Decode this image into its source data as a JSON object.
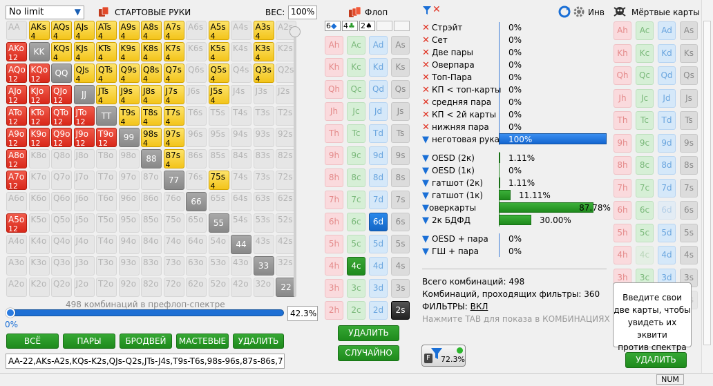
{
  "left": {
    "limit_select": "No limit",
    "title": "СТАРТОВЫЕ РУКИ",
    "weight_label": "ВЕС:",
    "weight_value": "100%",
    "combos_caption": "498 комбинаций в префлоп-спектре",
    "slider_low": "0%",
    "slider_value": "42.3%",
    "buttons": [
      "ВСЁ",
      "ПАРЫ",
      "БРОДВЕЙ",
      "МАСТЕВЫЕ",
      "УДАЛИТЬ"
    ],
    "range_text": "AA-22,AKs-A2s,KQs-K2s,QJs-Q2s,JTs-J4s,T9s-T6s,98s-96s,87s-86s,7",
    "grid": [
      [
        [
          "AA",
          "",
          "e"
        ],
        [
          "AKs",
          "4",
          "y"
        ],
        [
          "AQs",
          "4",
          "y"
        ],
        [
          "AJs",
          "4",
          "y"
        ],
        [
          "ATs",
          "4",
          "y"
        ],
        [
          "A9s",
          "4",
          "y"
        ],
        [
          "A8s",
          "4",
          "y"
        ],
        [
          "A7s",
          "4",
          "y"
        ],
        [
          "A6s",
          "",
          "e"
        ],
        [
          "A5s",
          "4",
          "y"
        ],
        [
          "A4s",
          "",
          "e"
        ],
        [
          "A3s",
          "4",
          "y"
        ],
        [
          "A2s",
          "",
          "e"
        ]
      ],
      [
        [
          "AKo",
          "12",
          "r"
        ],
        [
          "KK",
          "",
          "p"
        ],
        [
          "KQs",
          "4",
          "y"
        ],
        [
          "KJs",
          "4",
          "y"
        ],
        [
          "KTs",
          "4",
          "y"
        ],
        [
          "K9s",
          "4",
          "y"
        ],
        [
          "K8s",
          "4",
          "y"
        ],
        [
          "K7s",
          "4",
          "y"
        ],
        [
          "K6s",
          "",
          "e"
        ],
        [
          "K5s",
          "4",
          "y"
        ],
        [
          "K4s",
          "",
          "e"
        ],
        [
          "K3s",
          "4",
          "y"
        ],
        [
          "K2s",
          "",
          "e"
        ]
      ],
      [
        [
          "AQo",
          "12",
          "r"
        ],
        [
          "KQo",
          "12",
          "r"
        ],
        [
          "QQ",
          "",
          "p"
        ],
        [
          "QJs",
          "4",
          "y"
        ],
        [
          "QTs",
          "4",
          "y"
        ],
        [
          "Q9s",
          "4",
          "y"
        ],
        [
          "Q8s",
          "4",
          "y"
        ],
        [
          "Q7s",
          "4",
          "y"
        ],
        [
          "Q6s",
          "",
          "e"
        ],
        [
          "Q5s",
          "4",
          "y"
        ],
        [
          "Q4s",
          "",
          "e"
        ],
        [
          "Q3s",
          "4",
          "y"
        ],
        [
          "Q2s",
          "",
          "e"
        ]
      ],
      [
        [
          "AJo",
          "12",
          "r"
        ],
        [
          "KJo",
          "12",
          "r"
        ],
        [
          "QJo",
          "12",
          "r"
        ],
        [
          "JJ",
          "",
          "p"
        ],
        [
          "JTs",
          "4",
          "y"
        ],
        [
          "J9s",
          "4",
          "y"
        ],
        [
          "J8s",
          "4",
          "y"
        ],
        [
          "J7s",
          "4",
          "y"
        ],
        [
          "J6s",
          "",
          "e"
        ],
        [
          "J5s",
          "4",
          "y"
        ],
        [
          "J4s",
          "",
          "e"
        ],
        [
          "J3s",
          "",
          "e"
        ],
        [
          "J2s",
          "",
          "e"
        ]
      ],
      [
        [
          "ATo",
          "12",
          "r"
        ],
        [
          "KTo",
          "12",
          "r"
        ],
        [
          "QTo",
          "12",
          "r"
        ],
        [
          "JTo",
          "12",
          "r"
        ],
        [
          "TT",
          "",
          "p"
        ],
        [
          "T9s",
          "4",
          "y"
        ],
        [
          "T8s",
          "4",
          "y"
        ],
        [
          "T7s",
          "4",
          "y"
        ],
        [
          "T6s",
          "",
          "e"
        ],
        [
          "T5s",
          "",
          "e"
        ],
        [
          "T4s",
          "",
          "e"
        ],
        [
          "T3s",
          "",
          "e"
        ],
        [
          "T2s",
          "",
          "e"
        ]
      ],
      [
        [
          "A9o",
          "12",
          "r"
        ],
        [
          "K9o",
          "12",
          "r"
        ],
        [
          "Q9o",
          "12",
          "r"
        ],
        [
          "J9o",
          "12",
          "r"
        ],
        [
          "T9o",
          "12",
          "r"
        ],
        [
          "99",
          "",
          "p"
        ],
        [
          "98s",
          "4",
          "y"
        ],
        [
          "97s",
          "4",
          "y"
        ],
        [
          "96s",
          "",
          "e"
        ],
        [
          "95s",
          "",
          "e"
        ],
        [
          "94s",
          "",
          "e"
        ],
        [
          "93s",
          "",
          "e"
        ],
        [
          "92s",
          "",
          "e"
        ]
      ],
      [
        [
          "A8o",
          "12",
          "r"
        ],
        [
          "K8o",
          "",
          "e"
        ],
        [
          "Q8o",
          "",
          "e"
        ],
        [
          "J8o",
          "",
          "e"
        ],
        [
          "T8o",
          "",
          "e"
        ],
        [
          "98o",
          "",
          "e"
        ],
        [
          "88",
          "",
          "p"
        ],
        [
          "87s",
          "4",
          "y"
        ],
        [
          "86s",
          "",
          "e"
        ],
        [
          "85s",
          "",
          "e"
        ],
        [
          "84s",
          "",
          "e"
        ],
        [
          "83s",
          "",
          "e"
        ],
        [
          "82s",
          "",
          "e"
        ]
      ],
      [
        [
          "A7o",
          "12",
          "r"
        ],
        [
          "K7o",
          "",
          "e"
        ],
        [
          "Q7o",
          "",
          "e"
        ],
        [
          "J7o",
          "",
          "e"
        ],
        [
          "T7o",
          "",
          "e"
        ],
        [
          "97o",
          "",
          "e"
        ],
        [
          "87o",
          "",
          "e"
        ],
        [
          "77",
          "",
          "p"
        ],
        [
          "76s",
          "",
          "e"
        ],
        [
          "75s",
          "4",
          "y"
        ],
        [
          "74s",
          "",
          "e"
        ],
        [
          "73s",
          "",
          "e"
        ],
        [
          "72s",
          "",
          "e"
        ]
      ],
      [
        [
          "A6o",
          "",
          "e"
        ],
        [
          "K6o",
          "",
          "e"
        ],
        [
          "Q6o",
          "",
          "e"
        ],
        [
          "J6o",
          "",
          "e"
        ],
        [
          "T6o",
          "",
          "e"
        ],
        [
          "96o",
          "",
          "e"
        ],
        [
          "86o",
          "",
          "e"
        ],
        [
          "76o",
          "",
          "e"
        ],
        [
          "66",
          "",
          "p"
        ],
        [
          "65s",
          "",
          "e"
        ],
        [
          "64s",
          "",
          "e"
        ],
        [
          "63s",
          "",
          "e"
        ],
        [
          "62s",
          "",
          "e"
        ]
      ],
      [
        [
          "A5o",
          "12",
          "r"
        ],
        [
          "K5o",
          "",
          "e"
        ],
        [
          "Q5o",
          "",
          "e"
        ],
        [
          "J5o",
          "",
          "e"
        ],
        [
          "T5o",
          "",
          "e"
        ],
        [
          "95o",
          "",
          "e"
        ],
        [
          "85o",
          "",
          "e"
        ],
        [
          "75o",
          "",
          "e"
        ],
        [
          "65o",
          "",
          "e"
        ],
        [
          "55",
          "",
          "p"
        ],
        [
          "54s",
          "",
          "e"
        ],
        [
          "53s",
          "",
          "e"
        ],
        [
          "52s",
          "",
          "e"
        ]
      ],
      [
        [
          "A4o",
          "",
          "e"
        ],
        [
          "K4o",
          "",
          "e"
        ],
        [
          "Q4o",
          "",
          "e"
        ],
        [
          "J4o",
          "",
          "e"
        ],
        [
          "T4o",
          "",
          "e"
        ],
        [
          "94o",
          "",
          "e"
        ],
        [
          "84o",
          "",
          "e"
        ],
        [
          "74o",
          "",
          "e"
        ],
        [
          "64o",
          "",
          "e"
        ],
        [
          "54o",
          "",
          "e"
        ],
        [
          "44",
          "",
          "p"
        ],
        [
          "43s",
          "",
          "e"
        ],
        [
          "42s",
          "",
          "e"
        ]
      ],
      [
        [
          "A3o",
          "",
          "e"
        ],
        [
          "K3o",
          "",
          "e"
        ],
        [
          "Q3o",
          "",
          "e"
        ],
        [
          "J3o",
          "",
          "e"
        ],
        [
          "T3o",
          "",
          "e"
        ],
        [
          "93o",
          "",
          "e"
        ],
        [
          "83o",
          "",
          "e"
        ],
        [
          "73o",
          "",
          "e"
        ],
        [
          "63o",
          "",
          "e"
        ],
        [
          "53o",
          "",
          "e"
        ],
        [
          "43o",
          "",
          "e"
        ],
        [
          "33",
          "",
          "p"
        ],
        [
          "32s",
          "",
          "e"
        ]
      ],
      [
        [
          "A2o",
          "",
          "e"
        ],
        [
          "K2o",
          "",
          "e"
        ],
        [
          "Q2o",
          "",
          "e"
        ],
        [
          "J2o",
          "",
          "e"
        ],
        [
          "T2o",
          "",
          "e"
        ],
        [
          "92o",
          "",
          "e"
        ],
        [
          "82o",
          "",
          "e"
        ],
        [
          "72o",
          "",
          "e"
        ],
        [
          "62o",
          "",
          "e"
        ],
        [
          "52o",
          "",
          "e"
        ],
        [
          "42o",
          "",
          "e"
        ],
        [
          "32o",
          "",
          "e"
        ],
        [
          "22",
          "",
          "p"
        ]
      ]
    ]
  },
  "flop": {
    "title": "Флоп",
    "slots": [
      "6",
      "4",
      "2",
      "",
      ""
    ],
    "ranks": [
      "A",
      "K",
      "Q",
      "J",
      "T",
      "9",
      "8",
      "7",
      "6",
      "5",
      "4",
      "3",
      "2"
    ],
    "selected": {
      "6d": "d",
      "4c": "c",
      "2s": "s"
    },
    "delete_label": "УДАЛИТЬ",
    "random_label": "СЛУЧАЙНО"
  },
  "filters": {
    "equity_label": "Инв",
    "made": [
      {
        "label": "Стрэйт",
        "value": "0%",
        "pct": 0
      },
      {
        "label": "Сет",
        "value": "0%",
        "pct": 0
      },
      {
        "label": "Две пары",
        "value": "0%",
        "pct": 0
      },
      {
        "label": "Оверпара",
        "value": "0%",
        "pct": 0
      },
      {
        "label": "Топ-Пара",
        "value": "0%",
        "pct": 0
      },
      {
        "label": "КП < топ-карты",
        "value": "0%",
        "pct": 0
      },
      {
        "label": "средняя пара",
        "value": "0%",
        "pct": 0
      },
      {
        "label": "КП < 2й карты",
        "value": "0%",
        "pct": 0
      },
      {
        "label": "нижняя пара",
        "value": "0%",
        "pct": 0
      },
      {
        "label": "неготовая рука",
        "value": "100%",
        "pct": 100
      }
    ],
    "draws": [
      {
        "label": "OESD (2к)",
        "value": "1.11%",
        "pct": 1.11
      },
      {
        "label": "OESD (1к)",
        "value": "0%",
        "pct": 0
      },
      {
        "label": "гатшот (2к)",
        "value": "1.11%",
        "pct": 1.11
      },
      {
        "label": "гатшот (1к)",
        "value": "11.11%",
        "pct": 11.11
      },
      {
        "label": "оверкарты",
        "value": "87.78%",
        "pct": 87.78
      },
      {
        "label": "2к БДФД",
        "value": "30.00%",
        "pct": 30
      }
    ],
    "combos": [
      {
        "label": "OESD + пара",
        "value": "0%"
      },
      {
        "label": "ГШ + пара",
        "value": "0%"
      }
    ],
    "total_combos": "Всего комбинаций: 498",
    "passing_combos": "Комбинаций, проходящих фильтры: 360",
    "filters_label": "ФИЛЬТРЫ:",
    "filters_value": "ВКЛ",
    "hint": "Нажмите TAB для показа в КОМБИНАЦИЯХ",
    "badge_pct": "72.3%"
  },
  "dead": {
    "title": "Мёртвые карты",
    "box_text": [
      "Введите свои",
      "две карты, чтобы",
      "увидеть их эквити",
      "против спектра"
    ],
    "delete_label": "УДАЛИТЬ"
  },
  "status": {
    "num": "NUM"
  }
}
